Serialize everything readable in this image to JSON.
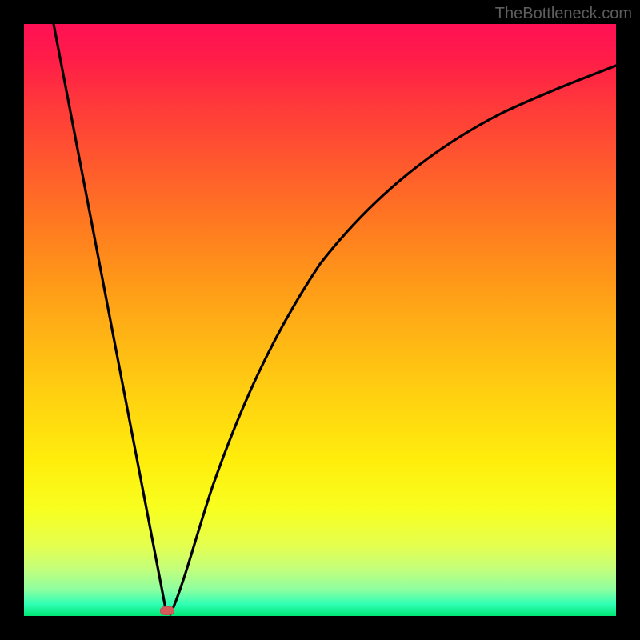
{
  "watermark": "TheBottleneck.com",
  "colors": {
    "frame": "#000000",
    "curve": "#000000",
    "marker": "#d75a5a",
    "gradient_top": "#ff1054",
    "gradient_bottom": "#00e676"
  },
  "chart_data": {
    "type": "line",
    "title": "",
    "xlabel": "",
    "ylabel": "",
    "xlim": [
      0,
      100
    ],
    "ylim": [
      0,
      100
    ],
    "x": [
      0,
      5,
      10,
      15,
      20,
      22,
      24,
      26,
      28,
      30,
      35,
      40,
      45,
      50,
      55,
      60,
      65,
      70,
      75,
      80,
      85,
      90,
      95,
      100
    ],
    "values": [
      100,
      80,
      60,
      40,
      20,
      10,
      0,
      8,
      18,
      28,
      45,
      58,
      67,
      73,
      78,
      82,
      85,
      87.5,
      89.5,
      91,
      92.5,
      93.7,
      94.7,
      95.5
    ],
    "minimum": {
      "x": 24,
      "y": 0
    }
  }
}
